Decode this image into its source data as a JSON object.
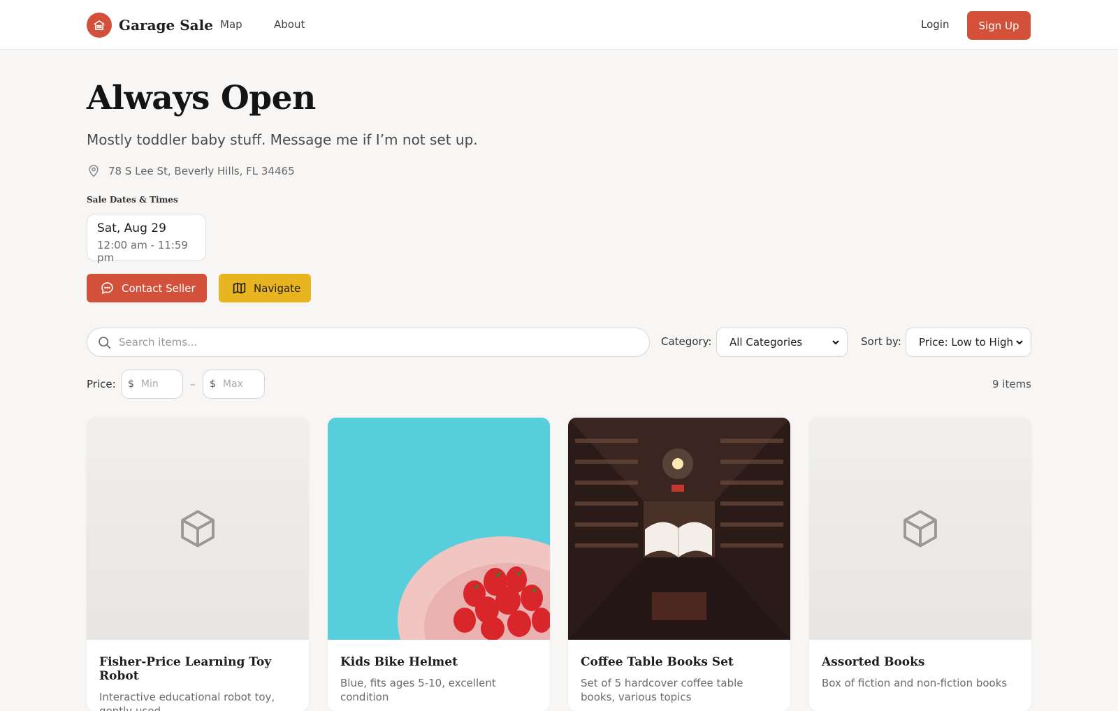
{
  "header": {
    "brand": "Garage Sale",
    "nav": [
      "Map",
      "About"
    ],
    "login": "Login",
    "signup": "Sign Up"
  },
  "sale": {
    "title": "Always Open",
    "subtitle": "Mostly toddler baby stuff. Message me if I’m not set up.",
    "address": "78 S Lee St, Beverly Hills, FL 34465",
    "dates_heading": "Sale Dates & Times",
    "dates": [
      {
        "day": "Sat, Aug 29",
        "time": "12:00 am - 11:59 pm"
      }
    ],
    "contact_label": "Contact Seller",
    "navigate_label": "Navigate"
  },
  "filters": {
    "search_placeholder": "Search items...",
    "category_label": "Category:",
    "category_value": "All Categories",
    "sort_label": "Sort by:",
    "sort_value": "Price: Low to High",
    "price_label": "Price:",
    "currency": "$",
    "min_placeholder": "Min",
    "max_placeholder": "Max",
    "separator": "–",
    "item_count": "9 items"
  },
  "items": [
    {
      "title": "Fisher-Price Learning Toy Robot",
      "desc": "Interactive educational robot toy, gently used",
      "image": "box-icon"
    },
    {
      "title": "Kids Bike Helmet",
      "desc": "Blue, fits ages 5-10, excellent condition",
      "image": "photo-strawberries"
    },
    {
      "title": "Coffee Table Books Set",
      "desc": "Set of 5 hardcover coffee table books, various topics",
      "image": "photo-library"
    },
    {
      "title": "Assorted Books",
      "desc": "Box of fiction and non-fiction books",
      "image": "box-icon"
    }
  ],
  "colors": {
    "accent": "#d3513a",
    "navigate": "#e8b41f",
    "background": "#f7f6f5"
  }
}
